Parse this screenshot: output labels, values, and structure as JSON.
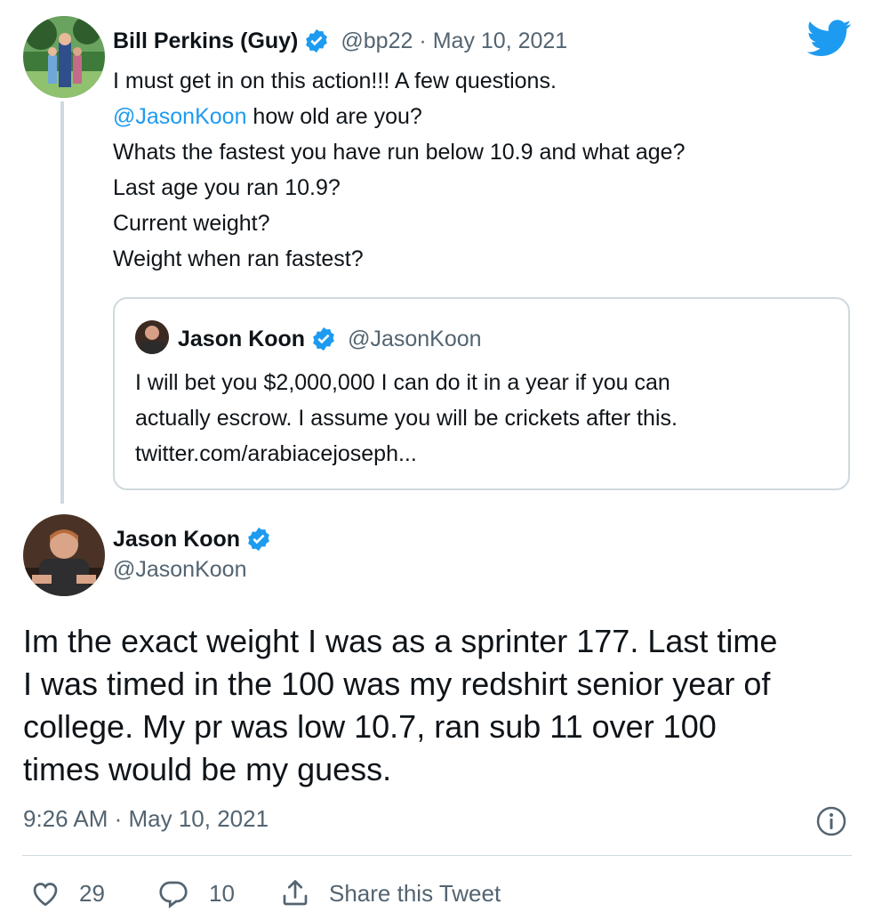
{
  "parent_tweet": {
    "display_name": "Bill Perkins (Guy)",
    "handle": "@bp22",
    "separator": "·",
    "date": "May 10, 2021",
    "lines": [
      {
        "mention": "",
        "text": "I must get in on this action!!! A few questions."
      },
      {
        "mention": "@JasonKoon",
        "text": " how old are you?"
      },
      {
        "mention": "",
        "text": "Whats the fastest you have run below 10.9 and what age?"
      },
      {
        "mention": "",
        "text": "Last age you ran 10.9?"
      },
      {
        "mention": "",
        "text": "Current weight?"
      },
      {
        "mention": "",
        "text": "Weight when ran fastest?"
      }
    ]
  },
  "quoted_tweet": {
    "display_name": "Jason Koon",
    "handle": "@JasonKoon",
    "lines": [
      "I will bet you $2,000,000 I can do it in a year if you can",
      "actually escrow. I assume you will be crickets after this.",
      "twitter.com/arabiacejoseph..."
    ]
  },
  "main_tweet": {
    "display_name": "Jason Koon",
    "handle": "@JasonKoon",
    "lines": [
      "Im the exact weight I was as a sprinter 177. Last time",
      "I was timed in the 100 was my redshirt senior year of",
      "college. My pr was low 10.7, ran sub 11 over 100",
      "times would be my guess."
    ],
    "timestamp": "9:26 AM · May 10, 2021",
    "actions": {
      "likes": "29",
      "replies": "10",
      "share_label": "Share this Tweet"
    }
  },
  "icons": {
    "twitter_logo": "twitter-bird-icon",
    "verified": "verified-badge-icon",
    "info": "info-icon",
    "like": "heart-icon",
    "reply": "reply-bubble-icon",
    "share": "share-icon"
  },
  "colors": {
    "brand_blue": "#1d9bf0",
    "text": "#0f1419",
    "muted": "#536471",
    "border": "#cfd9de"
  }
}
